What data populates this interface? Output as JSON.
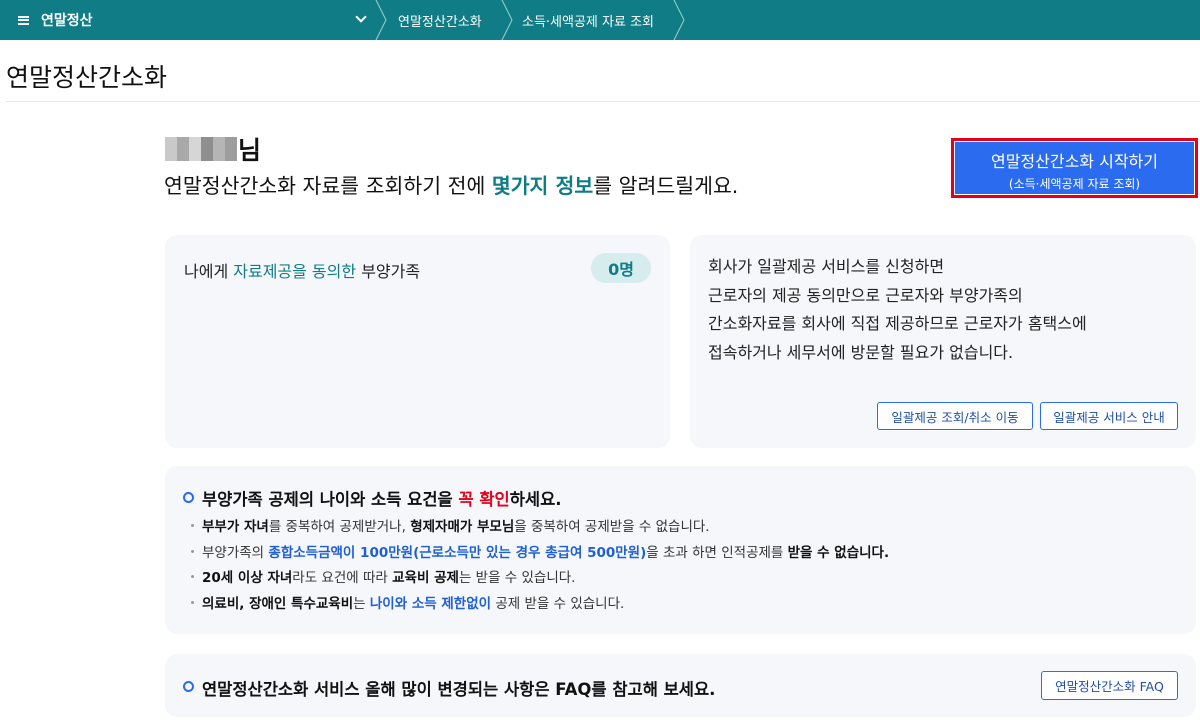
{
  "nav": {
    "menu_label": "연말정산",
    "breadcrumbs": [
      "연말정산간소화",
      "소득·세액공제 자료 조회"
    ]
  },
  "page": {
    "title": "연말정산간소화"
  },
  "greeting": {
    "name_suffix": "님",
    "intro_before": "연말정산간소화 자료를 조회하기 전에 ",
    "intro_highlight": "몇가지 정보",
    "intro_after": "를 알려드릴게요."
  },
  "start_button": {
    "label": "연말정산간소화 시작하기",
    "sublabel": "(소득·세액공제 자료 조회)"
  },
  "consent_card": {
    "prefix": "나에게 ",
    "highlight": "자료제공을 동의한",
    "suffix": " 부양가족",
    "count": "0명"
  },
  "bulk_card": {
    "lines": [
      "회사가 일괄제공 서비스를 신청하면",
      "근로자의 제공 동의만으로 근로자와 부양가족의",
      "간소화자료를 회사에 직접 제공하므로 근로자가 홈택스에",
      "접속하거나 세무서에 방문할 필요가 없습니다."
    ],
    "query_button": "일괄제공 조회/취소 이동",
    "guide_button": "일괄제공 서비스 안내"
  },
  "notice": {
    "head_before": "부양가족 공제의 나이와 소득 요건을 ",
    "head_red": "꼭 확인",
    "head_after": "하세요.",
    "item1": {
      "b1": "부부가 자녀",
      "t1": "를 중복하여 공제받거나, ",
      "b2": "형제자매가 부모님",
      "t2": "을 중복하여 공제받을 수 없습니다."
    },
    "item2": {
      "t1": "부양가족의 ",
      "blue": "종합소득금액이 100만원(근로소득만 있는 경우 총급여 500만원)",
      "t2": "을 초과 하면 인적공제를 ",
      "b1": "받을 수 없습니다."
    },
    "item3": {
      "b1": "20세 이상 자녀",
      "t1": "라도 요건에 따라 ",
      "b2": "교육비 공제",
      "t2": "는 받을 수 있습니다."
    },
    "item4": {
      "b1": "의료비, 장애인 특수교육비",
      "t1": "는 ",
      "blue": "나이와 소득 제한없이",
      "t2": " 공제 받을 수 있습니다."
    }
  },
  "faq": {
    "text": "연말정산간소화 서비스 올해 많이 변경되는 사항은 FAQ를 참고해 보세요.",
    "button": "연말정산간소화 FAQ"
  },
  "colors": {
    "nav_bg": "#0f7c86",
    "accent_teal": "#0f7c86",
    "primary_blue": "#2a6bf0",
    "highlight_red": "#e3001b",
    "card_bg": "#f5f7fb"
  }
}
